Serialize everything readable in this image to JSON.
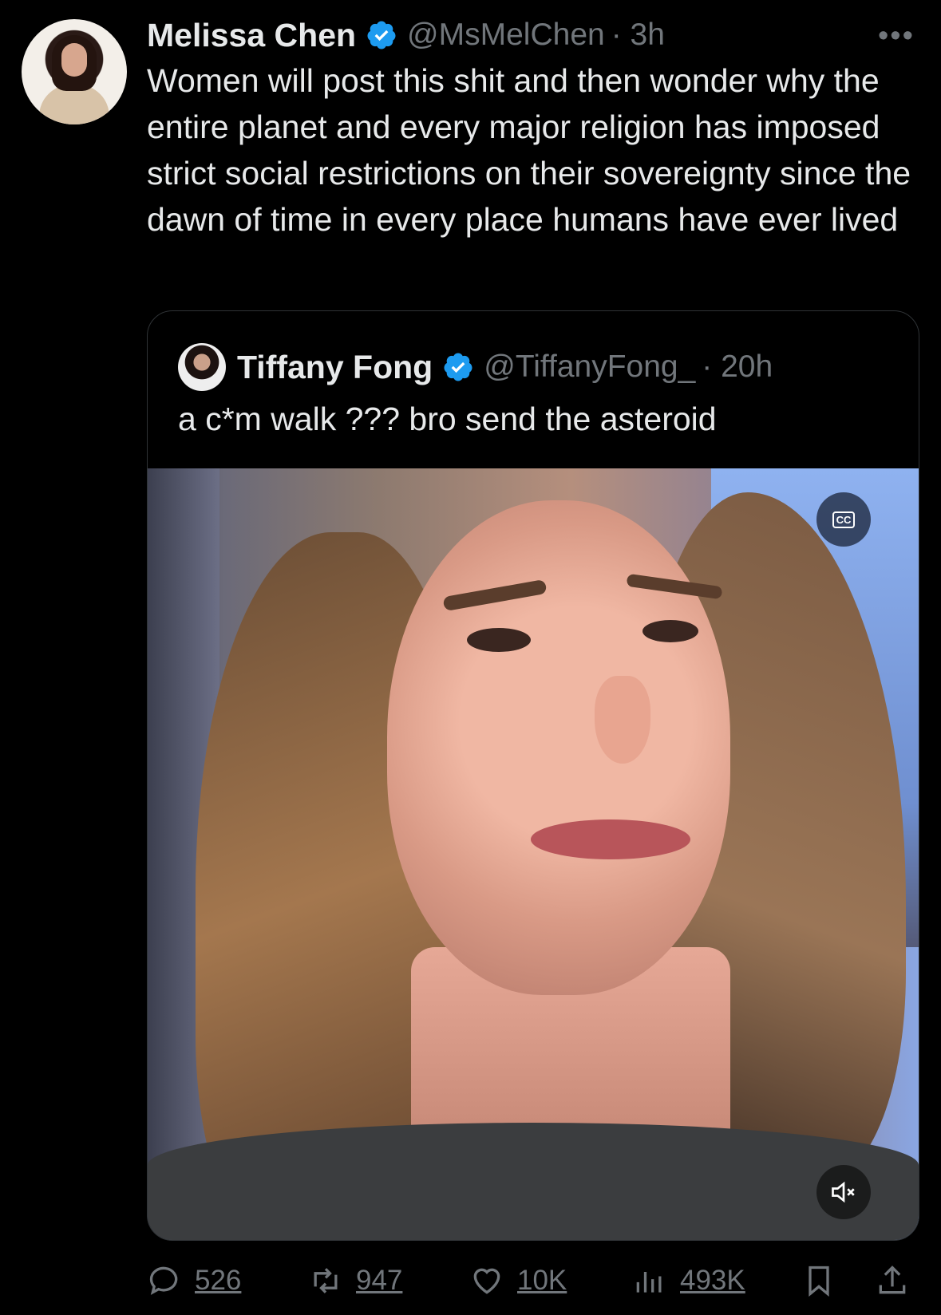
{
  "tweet": {
    "author_name": "Melissa Chen",
    "handle": "@MsMelChen",
    "time": "· 3h",
    "text": "Women will post this shit and then wonder why the entire planet and every major religion has imposed strict social restrictions on their sovereignty since the dawn of time in every place humans have ever lived",
    "more_icon": "more-horizontal-icon"
  },
  "quote": {
    "author_name": "Tiffany Fong",
    "handle": "@TiffanyFong_",
    "time": "· 20h",
    "text": "a c*m walk ??? bro send the asteroid",
    "cc_label": "CC"
  },
  "actions": {
    "replies": "526",
    "retweets": "947",
    "likes": "10K",
    "views": "493K"
  },
  "colors": {
    "background": "#000000",
    "text": "#e7e9ea",
    "muted": "#71767b",
    "verified": "#1d9bf0"
  }
}
